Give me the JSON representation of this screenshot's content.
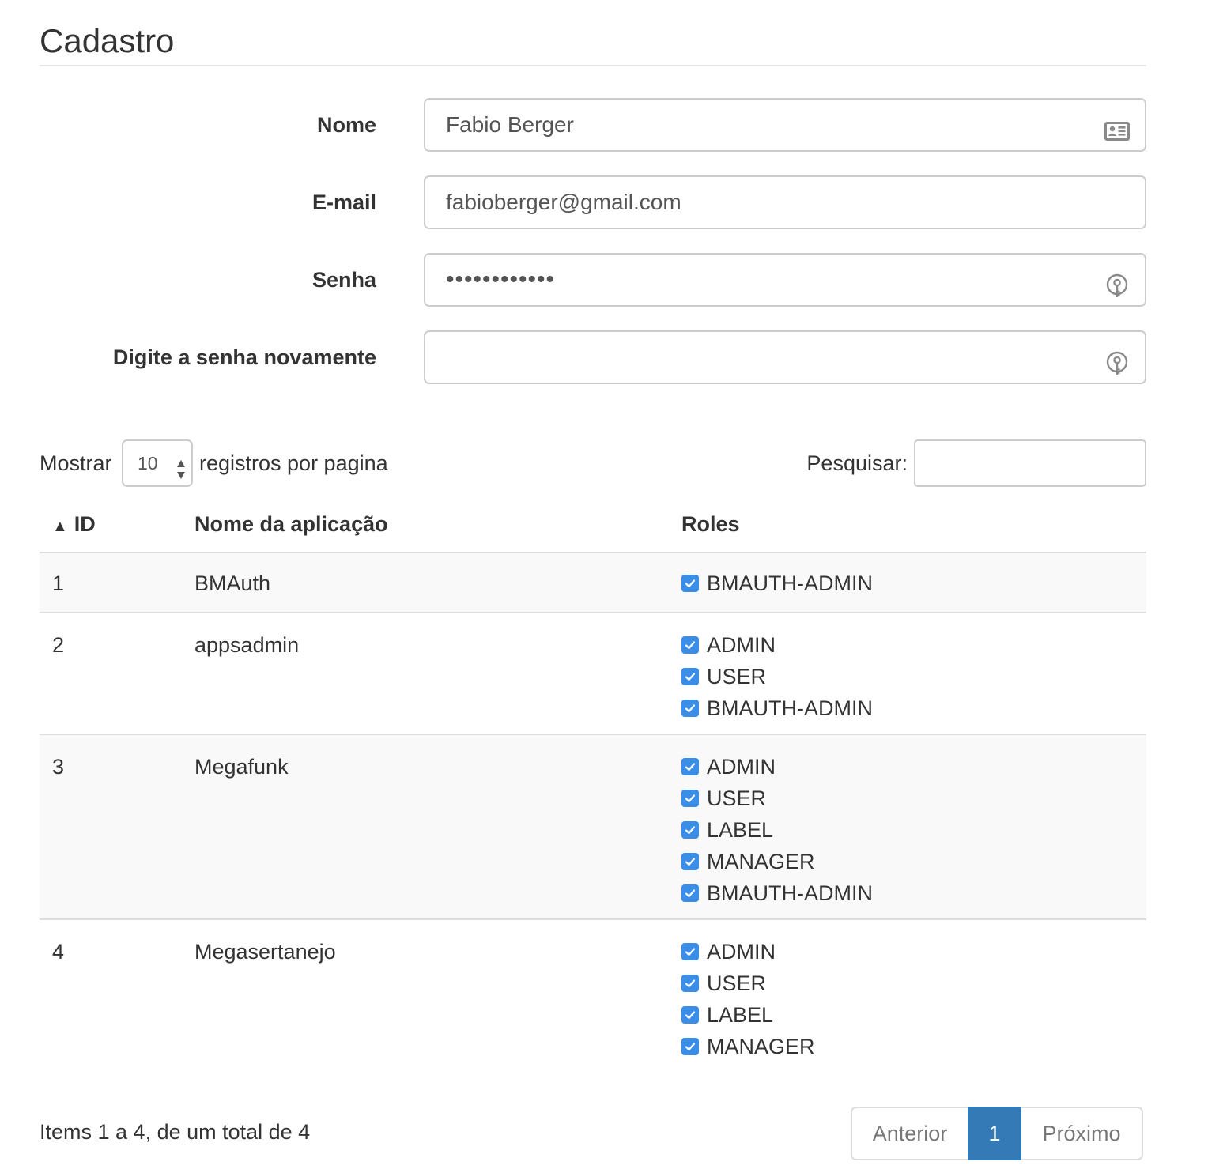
{
  "page": {
    "title": "Cadastro"
  },
  "form": {
    "name": {
      "label": "Nome",
      "value": "Fabio Berger",
      "icon": "contact-card-icon"
    },
    "email": {
      "label": "E-mail",
      "value": "fabioberger@gmail.com"
    },
    "password": {
      "label": "Senha",
      "value": "••••••••••••",
      "icon": "password-key-icon"
    },
    "password_confirm": {
      "label": "Digite a senha novamente",
      "value": "",
      "icon": "password-key-icon"
    }
  },
  "table_controls": {
    "show_label": "Mostrar",
    "page_length": "10",
    "per_page_label": "registros por pagina",
    "search_label": "Pesquisar:",
    "search_value": ""
  },
  "table": {
    "columns": [
      "ID",
      "Nome da aplicação",
      "Roles"
    ],
    "sort_indicator": "▲",
    "rows": [
      {
        "id": "1",
        "name": "BMAuth",
        "roles": [
          "BMAUTH-ADMIN"
        ]
      },
      {
        "id": "2",
        "name": "appsadmin",
        "roles": [
          "ADMIN",
          "USER",
          "BMAUTH-ADMIN"
        ]
      },
      {
        "id": "3",
        "name": "Megafunk",
        "roles": [
          "ADMIN",
          "USER",
          "LABEL",
          "MANAGER",
          "BMAUTH-ADMIN"
        ]
      },
      {
        "id": "4",
        "name": "Megasertanejo",
        "roles": [
          "ADMIN",
          "USER",
          "LABEL",
          "MANAGER"
        ]
      }
    ]
  },
  "footer": {
    "info": "Items 1 a 4, de um total de 4",
    "prev_label": "Anterior",
    "current_page": "1",
    "next_label": "Próximo"
  },
  "colors": {
    "accent": "#337ab7",
    "checkbox": "#3b8ee8",
    "border": "#cccccc",
    "row_stripe": "#f9f9f9"
  }
}
